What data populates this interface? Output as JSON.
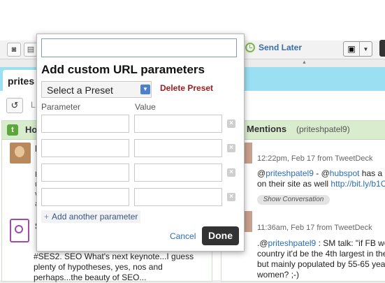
{
  "composer": {
    "send_later_label": "Send Later"
  },
  "tab": {
    "label": "prites"
  },
  "toolbar": {
    "refresh_trailing": "L"
  },
  "columns": {
    "left": {
      "title": "Ho",
      "tweet1_author_initial": "F",
      "tweet1_fragments": [
        "R",
        "u",
        "v",
        "a"
      ],
      "tweet2_author_initial": "S",
      "tweet2_text": "#SES2. SEO What's next keynote...I guess plenty of hypotheses, yes, nos and perhaps...the beauty of SEO..."
    },
    "right": {
      "title": "Mentions",
      "handle": "(priteshpatel9)",
      "tweet1": {
        "meta": "12:22pm, Feb 17 from TweetDeck",
        "at": "@",
        "user1": "priteshpatel9",
        "mid": " - @",
        "user2": "hubspot",
        "tail": " has a",
        "line2": "on their site as well ",
        "link": "http://bit.ly/b1C",
        "show_conversation": "Show Conversation"
      },
      "tweet2": {
        "meta": "11:36am, Feb 17 from TweetDeck",
        "line1_prefix": ".@",
        "line1_user": "priteshpatel9",
        "line1_tail": " : SM talk: \"if FB we",
        "line2": "country it'd be the 4th largest in the",
        "line3": "but mainly populated by 55-65 yea",
        "line4": "women? ;-)"
      }
    }
  },
  "dialog": {
    "url_value": "",
    "title": "Add custom URL parameters",
    "preset_select": "Select a Preset",
    "delete_preset": "Delete Preset",
    "header_parameter": "Parameter",
    "header_value": "Value",
    "rows": [
      {
        "parameter": "",
        "value": ""
      },
      {
        "parameter": "",
        "value": ""
      },
      {
        "parameter": "",
        "value": ""
      },
      {
        "parameter": "",
        "value": ""
      }
    ],
    "add_parameter": "Add another parameter",
    "cancel": "Cancel",
    "done": "Done"
  }
}
